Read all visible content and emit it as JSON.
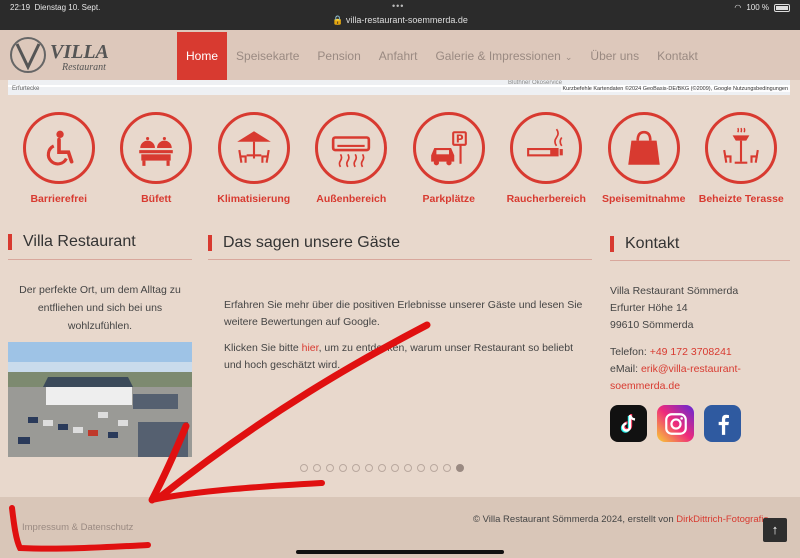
{
  "status": {
    "time": "22:19",
    "date": "Dienstag 10. Sept.",
    "url": "villa-restaurant-soemmerda.de",
    "battery": "100 %"
  },
  "logo": {
    "name": "VILLA",
    "sub": "Restaurant"
  },
  "nav": [
    {
      "label": "Home"
    },
    {
      "label": "Speisekarte"
    },
    {
      "label": "Pension"
    },
    {
      "label": "Anfahrt"
    },
    {
      "label": "Galerie & Impressionen"
    },
    {
      "label": "Über uns"
    },
    {
      "label": "Kontakt"
    }
  ],
  "map": {
    "street": "Erfurtecke",
    "poi": "Blüthner Ökoservice",
    "attribution": "Kurzbefehle   Kartendaten ©2024 GeoBasis-DE/BKG (©2009), Google   Nutzungsbedingungen"
  },
  "features": [
    {
      "label": "Barrierefrei",
      "icon": "wheelchair-icon"
    },
    {
      "label": "Büfett",
      "icon": "buffet-icon"
    },
    {
      "label": "Klimatisierung",
      "icon": "umbrella-table-icon"
    },
    {
      "label": "Außenbereich",
      "icon": "air-conditioner-icon"
    },
    {
      "label": "Parkplätze",
      "icon": "car-parking-icon"
    },
    {
      "label": "Raucherbereich",
      "icon": "cigarette-icon"
    },
    {
      "label": "Speisemitnahme",
      "icon": "shopping-bag-icon"
    },
    {
      "label": "Beheizte Terasse",
      "icon": "heater-terrace-icon"
    }
  ],
  "about": {
    "title": "Villa Restaurant",
    "text": "Der perfekte Ort, um dem Alltag zu entfliehen und sich bei uns wohlzufühlen."
  },
  "reviews": {
    "title": "Das sagen unsere Gäste",
    "p1": "Erfahren Sie mehr über die positiven Erlebnisse unserer Gäste und lesen Sie weitere Bewertungen auf Google.",
    "p2_before": "Klicken Sie bitte ",
    "p2_link": "hier",
    "p2_after": ", um zu entdecken, warum unser Restaurant so beliebt und hoch geschätzt wird.",
    "slide_count": 13,
    "active_slide": 13
  },
  "contact": {
    "title": "Kontakt",
    "name": "Villa Restaurant Sömmerda",
    "street": "Erfurter Höhe 14",
    "city": "99610 Sömmerda",
    "phone_label": "Telefon: ",
    "phone": "+49 172 3708241",
    "email_label": "eMail: ",
    "email_line1": "erik@villa-restaurant-",
    "email_line2": "soemmerda.de",
    "socials": [
      "tiktok-icon",
      "instagram-icon",
      "facebook-icon"
    ]
  },
  "footer": {
    "left": "Impressum & Datenschutz",
    "right_text": "© Villa Restaurant Sömmerda 2024, erstellt von ",
    "right_link": "DirkDittrich-Fotografie"
  },
  "colors": {
    "accent": "#d83a30",
    "background": "#e8d8cc",
    "annotation": "#e01010"
  }
}
